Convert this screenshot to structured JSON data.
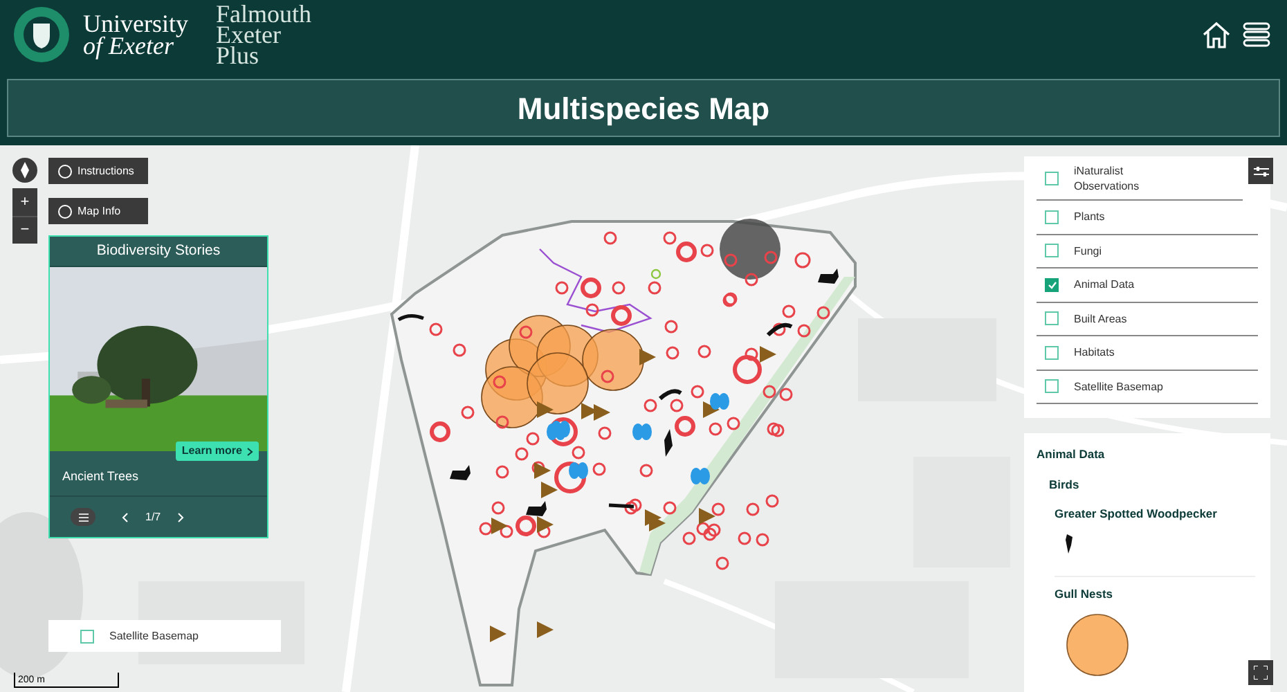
{
  "header": {
    "university_logo": [
      "University",
      "of Exeter"
    ],
    "partner_logo": [
      "Falmouth",
      "Exeter",
      "Plus"
    ]
  },
  "title": "Multispecies Map",
  "map_controls": {
    "buttons": [
      "Instructions",
      "Map Info"
    ],
    "zoom_in": "+",
    "zoom_out": "−"
  },
  "story_card": {
    "title": "Biodiversity Stories",
    "story_title": "Ancient Trees",
    "learn_more": "Learn more",
    "page": "1/7"
  },
  "layers": [
    {
      "label": "iNaturalist Observations",
      "checked": false
    },
    {
      "label": "Plants",
      "checked": false
    },
    {
      "label": "Fungi",
      "checked": false
    },
    {
      "label": "Animal Data",
      "checked": true
    },
    {
      "label": "Built Areas",
      "checked": false
    },
    {
      "label": "Habitats",
      "checked": false
    },
    {
      "label": "Satellite Basemap",
      "checked": false
    }
  ],
  "legend": {
    "title": "Animal Data",
    "group": "Birds",
    "items": [
      {
        "label": "Greater Spotted Woodpecker",
        "kind": "icon"
      },
      {
        "label": "Gull Nests",
        "kind": "circle"
      }
    ]
  },
  "basemap_toggle": {
    "label": "Satellite Basemap",
    "checked": false
  },
  "scale": "200 m"
}
